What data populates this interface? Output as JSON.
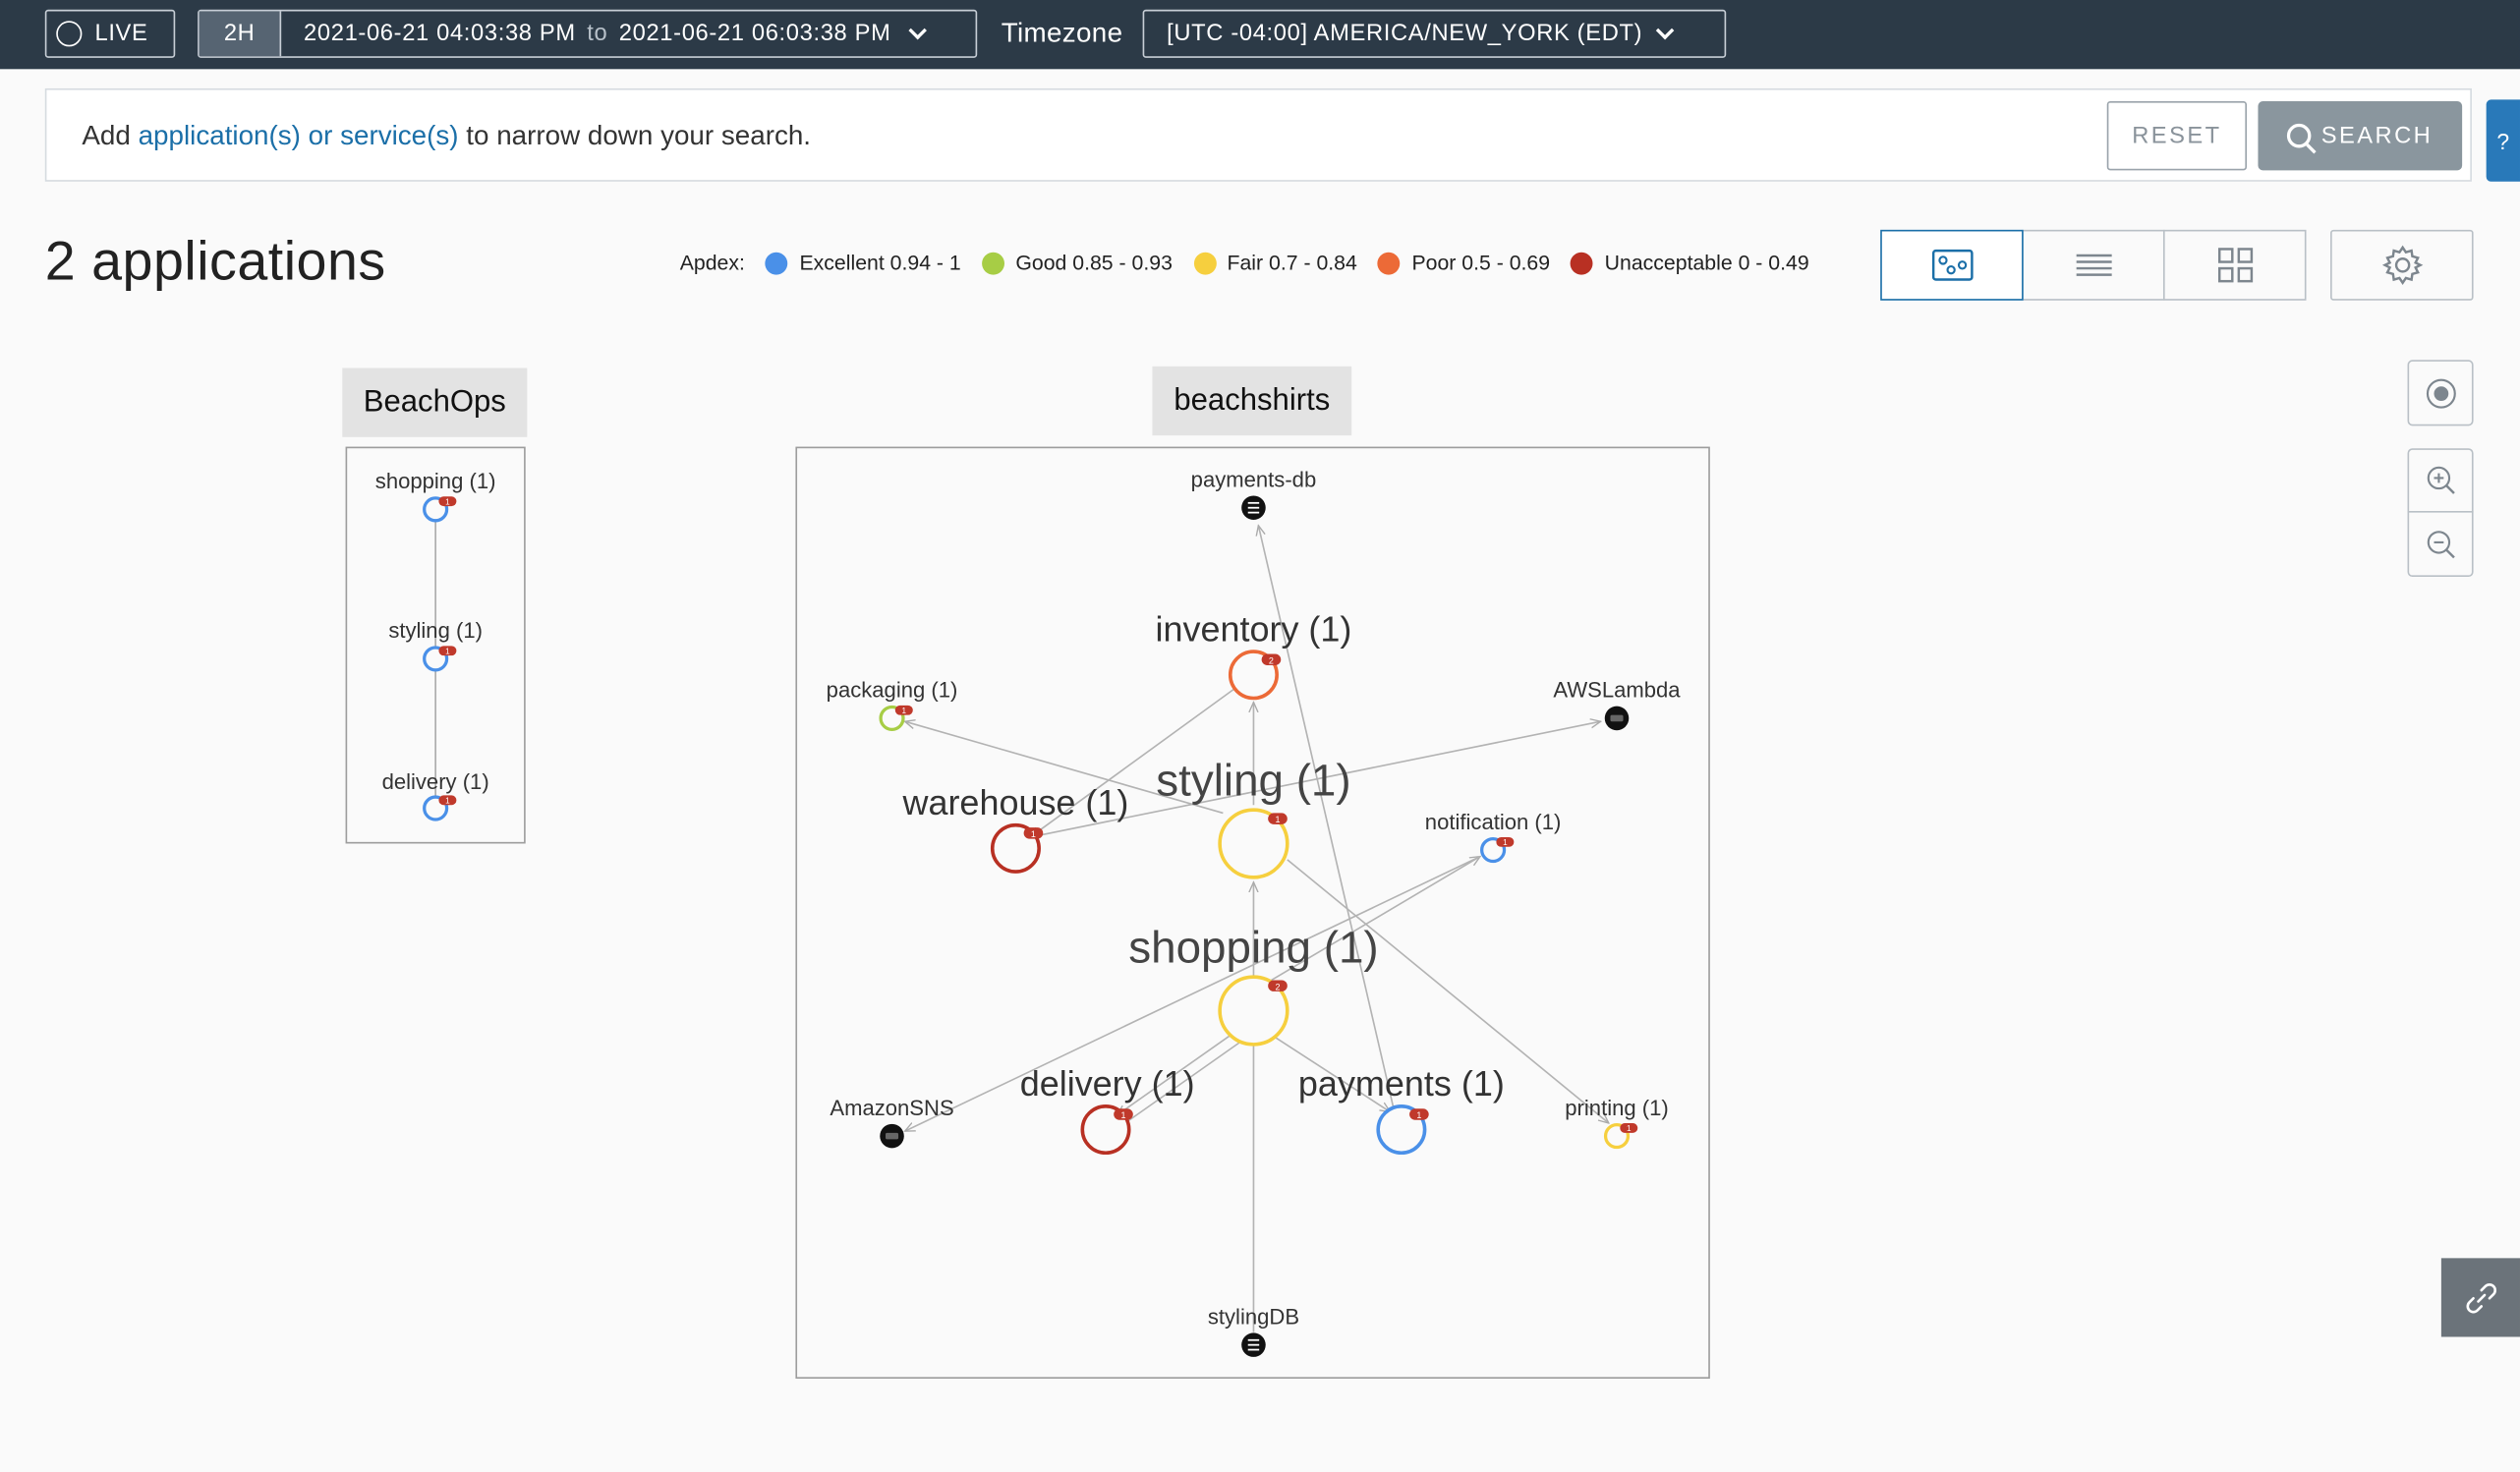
{
  "topbar": {
    "live_label": "LIVE",
    "range_preset": "2H",
    "range_start": "2021-06-21 04:03:38 PM",
    "range_to": "to",
    "range_end": "2021-06-21 06:03:38 PM",
    "timezone_label": "Timezone",
    "timezone_value": "[UTC -04:00] AMERICA/NEW_YORK (EDT)"
  },
  "search": {
    "prefix": "Add ",
    "link_text": "application(s) or service(s)",
    "suffix": " to narrow down your search.",
    "reset_label": "RESET",
    "search_label": "SEARCH",
    "help_label": "?"
  },
  "summary": {
    "title": "2 applications"
  },
  "apdex_legend": {
    "label": "Apdex:",
    "items": [
      {
        "label": "Excellent 0.94 - 1",
        "color": "#4a90e8"
      },
      {
        "label": "Good 0.85 - 0.93",
        "color": "#a7cd45"
      },
      {
        "label": "Fair 0.7 - 0.84",
        "color": "#f6cf3e"
      },
      {
        "label": "Poor 0.5 - 0.69",
        "color": "#ec6a37"
      },
      {
        "label": "Unacceptable 0 - 0.49",
        "color": "#b83023"
      }
    ]
  },
  "view_modes": [
    {
      "icon": "map-view-icon",
      "active": true
    },
    {
      "icon": "list-view-icon",
      "active": false
    },
    {
      "icon": "grid-view-icon",
      "active": false
    }
  ],
  "map_controls": [
    "recenter-icon",
    "zoom-in-icon",
    "zoom-out-icon"
  ],
  "applications": [
    {
      "name": "BeachOps",
      "nodes": [
        {
          "label": "shopping (1)",
          "color": "#4a90e8",
          "badge": "1"
        },
        {
          "label": "styling (1)",
          "color": "#4a90e8",
          "badge": "1"
        },
        {
          "label": "delivery (1)",
          "color": "#4a90e8",
          "badge": "1"
        }
      ]
    },
    {
      "name": "beachshirts",
      "nodes": [
        {
          "id": "paymentsdb",
          "label": "payments-db",
          "kind": "db"
        },
        {
          "id": "inventory",
          "label": "inventory (1)",
          "color": "#ec6a37",
          "badge": "2"
        },
        {
          "id": "packaging",
          "label": "packaging (1)",
          "color": "#a7cd45",
          "badge": "1"
        },
        {
          "id": "awslambda",
          "label": "AWSLambda",
          "kind": "ext"
        },
        {
          "id": "styling",
          "label": "styling (1)",
          "color": "#f6cf3e",
          "badge": "1"
        },
        {
          "id": "warehouse",
          "label": "warehouse (1)",
          "color": "#b83023",
          "badge": "1"
        },
        {
          "id": "notification",
          "label": "notification (1)",
          "color": "#4a90e8",
          "badge": "1"
        },
        {
          "id": "shopping",
          "label": "shopping (1)",
          "color": "#f6cf3e",
          "badge": "2"
        },
        {
          "id": "amazonsns",
          "label": "AmazonSNS",
          "kind": "ext"
        },
        {
          "id": "delivery",
          "label": "delivery (1)",
          "color": "#b83023",
          "badge": "1"
        },
        {
          "id": "payments",
          "label": "payments (1)",
          "color": "#4a90e8",
          "badge": "1"
        },
        {
          "id": "printing",
          "label": "printing (1)",
          "color": "#f6cf3e",
          "badge": "1"
        },
        {
          "id": "stylingdb",
          "label": "stylingDB",
          "kind": "db"
        }
      ]
    }
  ]
}
